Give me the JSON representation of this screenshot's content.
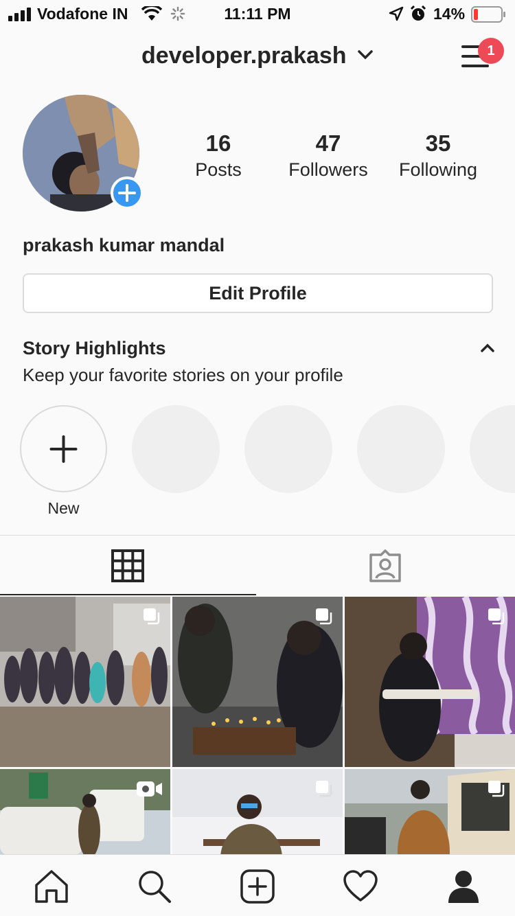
{
  "status_bar": {
    "carrier": "Vodafone IN",
    "time": "11:11 PM",
    "battery_percent": "14%"
  },
  "header": {
    "username": "developer.prakash",
    "notification_count": "1"
  },
  "profile": {
    "stats": [
      {
        "value": "16",
        "label": "Posts"
      },
      {
        "value": "47",
        "label": "Followers"
      },
      {
        "value": "35",
        "label": "Following"
      }
    ],
    "full_name": "prakash kumar mandal",
    "edit_profile_label": "Edit Profile"
  },
  "highlights": {
    "title": "Story Highlights",
    "subtitle": "Keep your favorite stories on your profile",
    "new_label": "New"
  },
  "tabs": [
    {
      "icon": "grid-icon",
      "active": true
    },
    {
      "icon": "tagged-icon",
      "active": false
    }
  ],
  "posts": [
    {
      "type": "multi",
      "desc": "group-photo"
    },
    {
      "type": "multi",
      "desc": "birthday-cake"
    },
    {
      "type": "multi",
      "desc": "guitar"
    },
    {
      "type": "video",
      "desc": "street-car"
    },
    {
      "type": "multi",
      "desc": "snow"
    },
    {
      "type": "multi",
      "desc": "car-door"
    }
  ],
  "bottom_nav": [
    "home-icon",
    "search-icon",
    "add-post-icon",
    "heart-icon",
    "profile-icon"
  ],
  "colors": {
    "accent_blue": "#3897f0",
    "badge_red": "#ed4956",
    "text": "#262626",
    "border": "#dbdbdb"
  }
}
